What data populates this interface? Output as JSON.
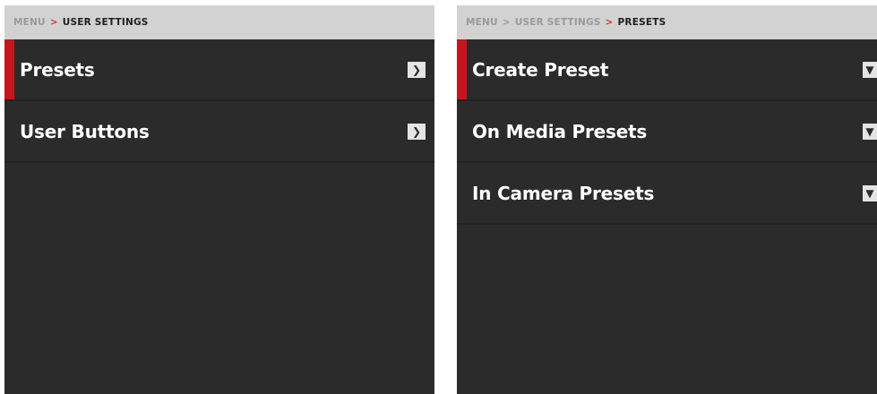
{
  "left_panel": {
    "breadcrumb": {
      "root": "MENU",
      "separator": ">",
      "current": "USER SETTINGS"
    },
    "items": [
      {
        "label": "Presets",
        "icon": "chevron-right-icon",
        "selected": true
      },
      {
        "label": "User Buttons",
        "icon": "chevron-right-icon",
        "selected": false
      }
    ]
  },
  "right_panel": {
    "breadcrumb": {
      "root": "MENU",
      "separator": ">",
      "middle": "USER SETTINGS",
      "current": "PRESETS"
    },
    "items": [
      {
        "label": "Create Preset",
        "icon": "chevron-down-icon",
        "selected": true
      },
      {
        "label": "On Media Presets",
        "icon": "chevron-down-icon",
        "selected": false
      },
      {
        "label": "In Camera Presets",
        "icon": "chevron-down-icon",
        "selected": false
      }
    ]
  },
  "colors": {
    "panel_background": "#2b2b2b",
    "breadcrumb_background": "#d2d2d2",
    "selection_accent": "#c9141f",
    "breadcrumb_separator": "#e63227"
  }
}
